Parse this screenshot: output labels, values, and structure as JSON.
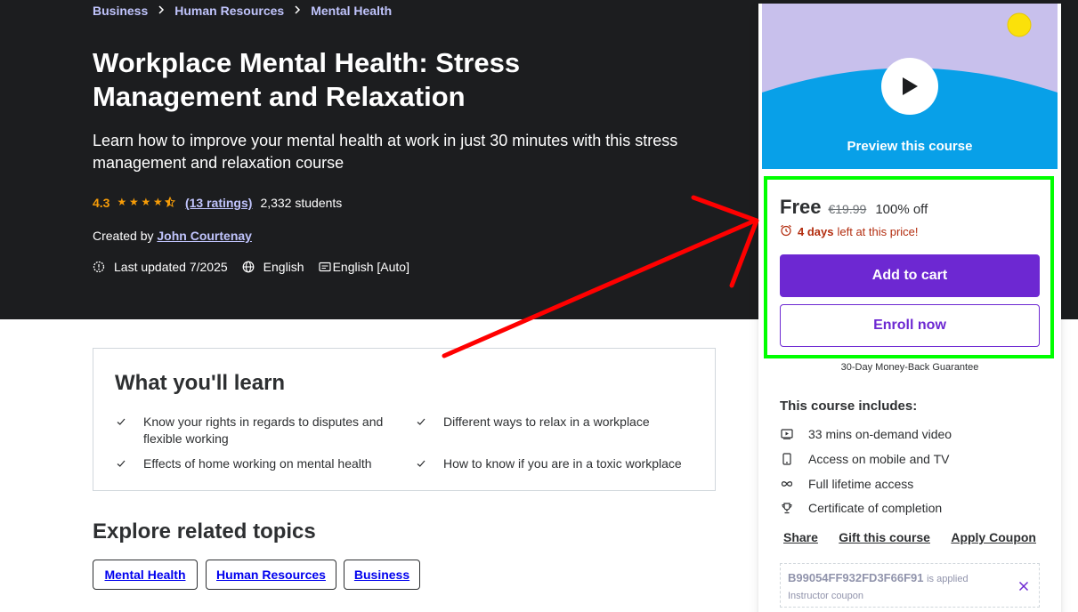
{
  "breadcrumb": [
    "Business",
    "Human Resources",
    "Mental Health"
  ],
  "course": {
    "title": "Workplace Mental Health: Stress Management and Relaxation",
    "subtitle": "Learn how to improve your mental health at work in just 30 minutes with this stress management and relaxation course",
    "rating": "4.3",
    "stars": 4.3,
    "ratings_count": "(13 ratings)",
    "students": "2,332 students",
    "created_by_label": "Created by",
    "instructor": "John Courtenay",
    "last_updated": "Last updated 7/2025",
    "language": "English",
    "captions": "English [Auto]"
  },
  "learn": {
    "title": "What you'll learn",
    "items": [
      "Know your rights in regards to disputes and flexible working",
      "Different ways to relax in a workplace",
      "Effects of home working on mental health",
      "How to know if you are in a toxic workplace"
    ]
  },
  "topics": {
    "title": "Explore related topics",
    "items": [
      "Mental Health",
      "Human Resources",
      "Business"
    ]
  },
  "sidebar": {
    "preview_label": "Preview this course",
    "price": "Free",
    "original_price": "€19.99",
    "discount": "100% off",
    "timer_days": "4 days",
    "timer_text": "left at this price!",
    "add_to_cart": "Add to cart",
    "enroll_now": "Enroll now",
    "guarantee": "30-Day Money-Back Guarantee",
    "includes_title": "This course includes:",
    "includes": [
      {
        "icon": "video-icon",
        "text": "33 mins on-demand video"
      },
      {
        "icon": "mobile-icon",
        "text": "Access on mobile and TV"
      },
      {
        "icon": "infinity-icon",
        "text": "Full lifetime access"
      },
      {
        "icon": "trophy-icon",
        "text": "Certificate of completion"
      }
    ],
    "share": "Share",
    "gift": "Gift this course",
    "apply_coupon": "Apply Coupon",
    "coupon_code": "B99054FF932FD3F66F91",
    "coupon_applied": "is applied",
    "coupon_type": "Instructor coupon"
  },
  "colors": {
    "hero_bg": "#1c1d1f",
    "link": "#c0c4fc",
    "star": "#f69c08",
    "primary": "#6d28d2",
    "timer": "#b32d0f",
    "highlight_box": "#00ff00",
    "annotation_arrow": "#ff0000"
  }
}
